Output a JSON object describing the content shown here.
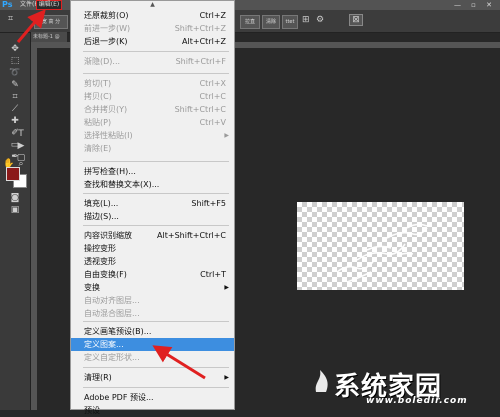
{
  "app": {
    "logo": "Ps"
  },
  "menubar": {
    "items": [
      "文件(F)",
      "编辑(E)"
    ],
    "window_controls": "— ▫ ✕"
  },
  "optionsbar": {
    "buttons": [
      "宽 高 分",
      "清除"
    ],
    "buttons_right": [
      "拉直",
      "ttet"
    ],
    "icons": [
      "crop-icon",
      "grid-icon",
      "gear-icon",
      "delete-cropped-pixels-icon"
    ]
  },
  "document": {
    "tab_label": "未标题-1 @"
  },
  "tools": [
    "move-icon",
    "marquee-icon",
    "lasso-icon",
    "quick-select-icon",
    "crop-icon",
    "eyedropper-icon",
    "healing-brush-icon",
    "brush-icon",
    "clone-stamp-icon",
    "history-brush-icon",
    "eraser-icon",
    "gradient-icon",
    "blur-icon",
    "dodge-icon",
    "pen-icon",
    "type-icon",
    "path-select-icon",
    "shape-icon",
    "hand-icon",
    "zoom-icon"
  ],
  "colors": {
    "foreground": "#8b1a1a",
    "background": "#ffffff",
    "highlight": "#3d8ee0",
    "menu_bg": "#f0f0f0"
  },
  "edit_menu": {
    "scroll_up": "▲",
    "items": [
      {
        "label": "还原裁剪(O)",
        "shortcut": "Ctrl+Z",
        "disabled": false
      },
      {
        "label": "前进一步(W)",
        "shortcut": "Shift+Ctrl+Z",
        "disabled": true
      },
      {
        "label": "后退一步(K)",
        "shortcut": "Alt+Ctrl+Z",
        "disabled": false
      },
      {
        "label": "渐隐(D)...",
        "shortcut": "Shift+Ctrl+F",
        "disabled": true
      },
      {
        "label": "剪切(T)",
        "shortcut": "Ctrl+X",
        "disabled": true
      },
      {
        "label": "拷贝(C)",
        "shortcut": "Ctrl+C",
        "disabled": true
      },
      {
        "label": "合并拷贝(Y)",
        "shortcut": "Shift+Ctrl+C",
        "disabled": true
      },
      {
        "label": "粘贴(P)",
        "shortcut": "Ctrl+V",
        "disabled": true
      },
      {
        "label": "选择性粘贴(I)",
        "shortcut": "",
        "submenu": true,
        "disabled": true
      },
      {
        "label": "清除(E)",
        "shortcut": "",
        "disabled": true
      },
      {
        "label": "拼写检查(H)...",
        "shortcut": "",
        "disabled": false
      },
      {
        "label": "查找和替换文本(X)...",
        "shortcut": "",
        "disabled": false
      },
      {
        "label": "填充(L)...",
        "shortcut": "Shift+F5",
        "disabled": false
      },
      {
        "label": "描边(S)...",
        "shortcut": "",
        "disabled": false
      },
      {
        "label": "内容识别缩放",
        "shortcut": "Alt+Shift+Ctrl+C",
        "disabled": false
      },
      {
        "label": "操控变形",
        "shortcut": "",
        "disabled": false
      },
      {
        "label": "透视变形",
        "shortcut": "",
        "disabled": false
      },
      {
        "label": "自由变换(F)",
        "shortcut": "Ctrl+T",
        "disabled": false
      },
      {
        "label": "变换",
        "shortcut": "",
        "submenu": true,
        "disabled": false
      },
      {
        "label": "自动对齐图层...",
        "shortcut": "",
        "disabled": true
      },
      {
        "label": "自动混合图层...",
        "shortcut": "",
        "disabled": true
      },
      {
        "label": "定义画笔预设(B)...",
        "shortcut": "",
        "disabled": false
      },
      {
        "label": "定义图案...",
        "shortcut": "",
        "disabled": false,
        "highlighted": true
      },
      {
        "label": "定义自定形状...",
        "shortcut": "",
        "disabled": true
      },
      {
        "label": "清理(R)",
        "shortcut": "",
        "submenu": true,
        "disabled": false
      },
      {
        "label": "Adobe PDF 预设...",
        "shortcut": "",
        "disabled": false
      },
      {
        "label": "预设",
        "shortcut": "",
        "disabled": false
      }
    ]
  },
  "watermark": {
    "title": "系统家园",
    "url": "www.boledir.com"
  }
}
